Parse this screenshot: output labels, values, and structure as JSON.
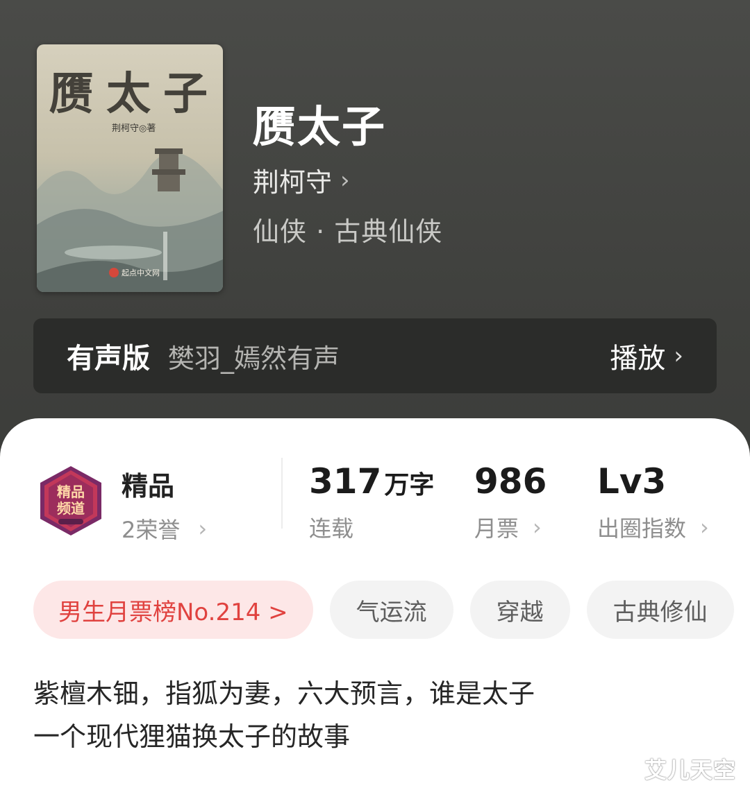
{
  "book": {
    "cover_title": "赝太子",
    "cover_author": "荆柯守◎著",
    "cover_publisher": "起点中文网",
    "title": "赝太子",
    "author": "荆柯守",
    "genre": "仙侠 · 古典仙侠"
  },
  "audio": {
    "label": "有声版",
    "narrator": "樊羽_嫣然有声",
    "play_label": "播放"
  },
  "honor": {
    "title": "精品",
    "count": "2荣誉",
    "badge_text": "精品频道"
  },
  "stats": {
    "words_value": "317",
    "words_unit": "万字",
    "words_label": "连载",
    "tickets_value": "986",
    "tickets_label": "月票",
    "level_value": "Lv3",
    "level_label": "出圈指数"
  },
  "tags": [
    "男生月票榜No.214 >",
    "气运流",
    "穿越",
    "古典修仙"
  ],
  "description": {
    "line1": "紫檀木钿，指狐为妻，六大预言，谁是太子",
    "line2": "一个现代狸猫换太子的故事"
  },
  "watermark": "艾儿天空",
  "colors": {
    "header_bg": "#434441",
    "rank_tag_bg": "#fde7e7",
    "rank_tag_text": "#e0423f",
    "tag_bg": "#f3f3f3"
  }
}
